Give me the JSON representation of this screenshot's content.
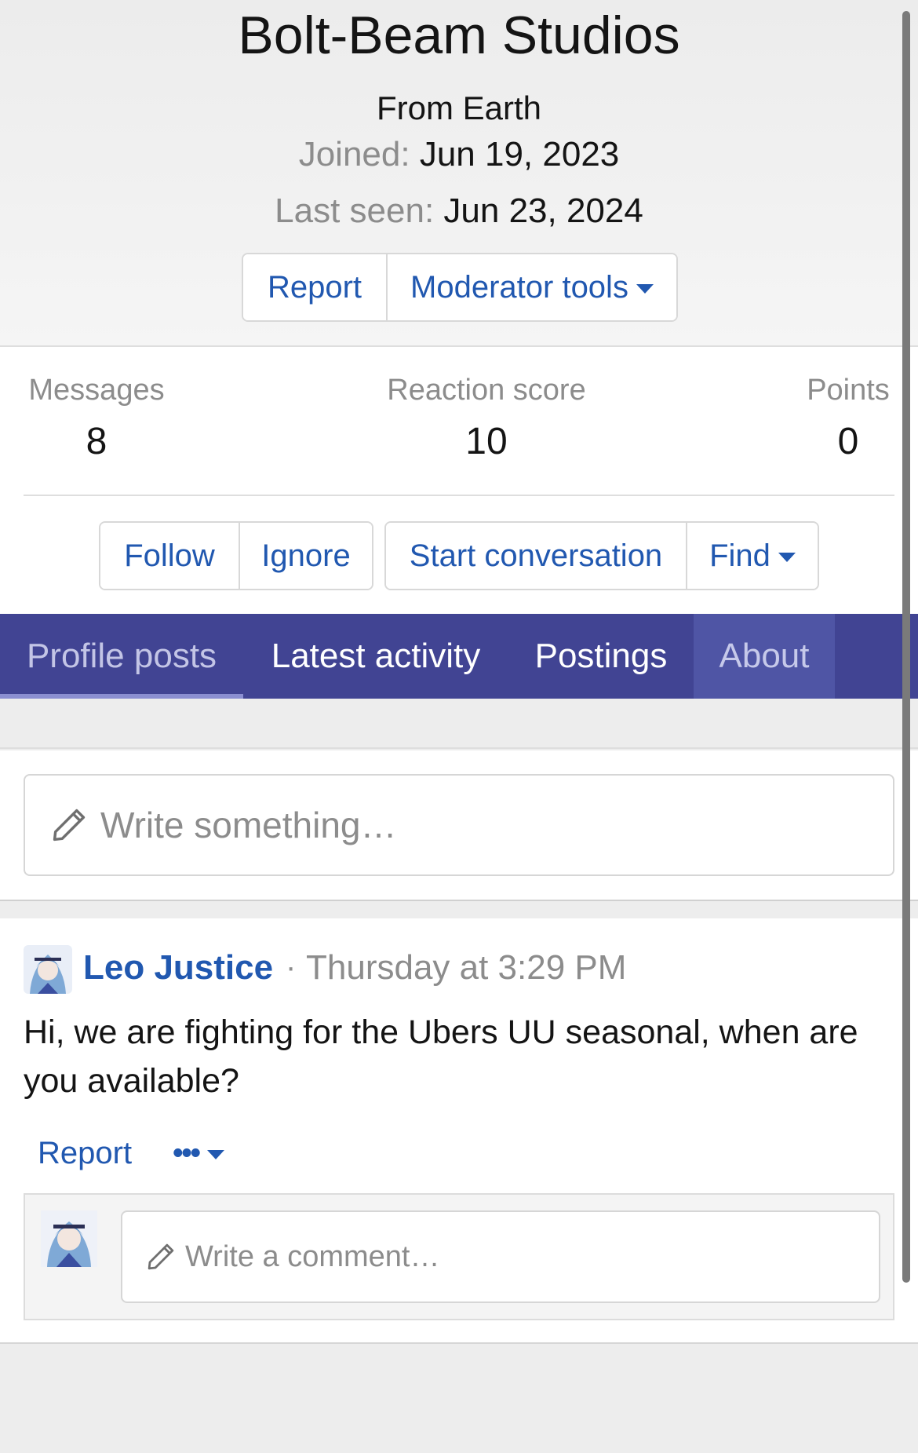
{
  "profile": {
    "name": "Bolt-Beam Studios",
    "location": "From Earth",
    "joined_label": "Joined:",
    "joined_value": "Jun 19, 2023",
    "last_seen_label": "Last seen:",
    "last_seen_value": "Jun 23, 2024"
  },
  "header_actions": {
    "report": "Report",
    "moderator_tools": "Moderator tools"
  },
  "stats": {
    "messages_label": "Messages",
    "messages_value": "8",
    "reaction_label": "Reaction score",
    "reaction_value": "10",
    "points_label": "Points",
    "points_value": "0"
  },
  "member_actions": {
    "follow": "Follow",
    "ignore": "Ignore",
    "start_conversation": "Start conversation",
    "find": "Find"
  },
  "tabs": [
    {
      "label": "Profile posts"
    },
    {
      "label": "Latest activity"
    },
    {
      "label": "Postings"
    },
    {
      "label": "About"
    }
  ],
  "composer": {
    "placeholder": "Write something…"
  },
  "post": {
    "author": "Leo Justice",
    "separator": "·",
    "time": "Thursday at 3:29 PM",
    "body": "Hi, we are fighting for the Ubers UU seasonal, when are you available?",
    "report": "Report",
    "more": "•••",
    "comment_placeholder": "Write a comment…"
  },
  "colors": {
    "link": "#2158b0",
    "tab_bar": "#414493",
    "tab_selected": "#4f55a5"
  },
  "icons": {
    "composer": "pencil-icon",
    "comment": "pencil-icon",
    "dropdown": "caret-down-icon"
  }
}
